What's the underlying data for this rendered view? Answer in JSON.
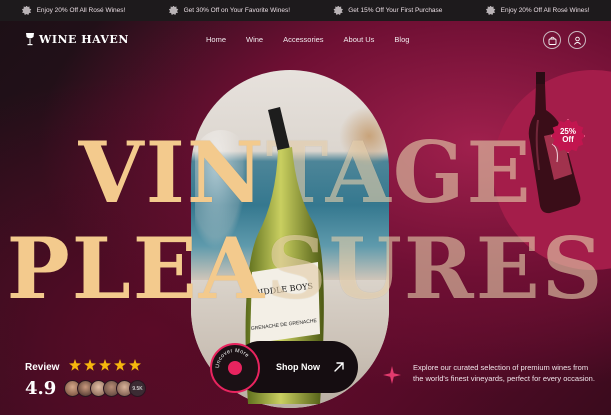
{
  "promo_bar": {
    "items": [
      "Enjoy 20% Off All Rosé Wines!",
      "Get 30% Off on Your Favorite Wines!",
      "Get 15% Off Your First Purchase",
      "Enjoy 20% Off All Rosé Wines!"
    ]
  },
  "header": {
    "logo_text": "WINE HAVEN",
    "nav": [
      "Home",
      "Wine",
      "Accessories",
      "About Us",
      "Blog"
    ]
  },
  "hero": {
    "title_line1_a": "VIN",
    "title_line1_b": "TAGE",
    "title_line2_a": "PLEA",
    "title_line2_b": "SURES",
    "bottle_label": "BIDDLE BOYS",
    "bottle_sublabel": "GRENACHE DE GRENACHE"
  },
  "promo_card": {
    "discount_line1": "25%",
    "discount_line2": "Off"
  },
  "review": {
    "label": "Review",
    "rating": "4.9",
    "star_count": 5,
    "customers": "9.5K"
  },
  "cta": {
    "shop_label": "Shop Now",
    "badge_text": "Uncover More"
  },
  "description": "Explore our curated selection of premium wines from the world's finest vineyards, perfect for every occasion.",
  "colors": {
    "accent": "#e8245f",
    "title": "#f3ca8d",
    "star": "#f6b70d",
    "promo_card": "#a41d4a"
  }
}
